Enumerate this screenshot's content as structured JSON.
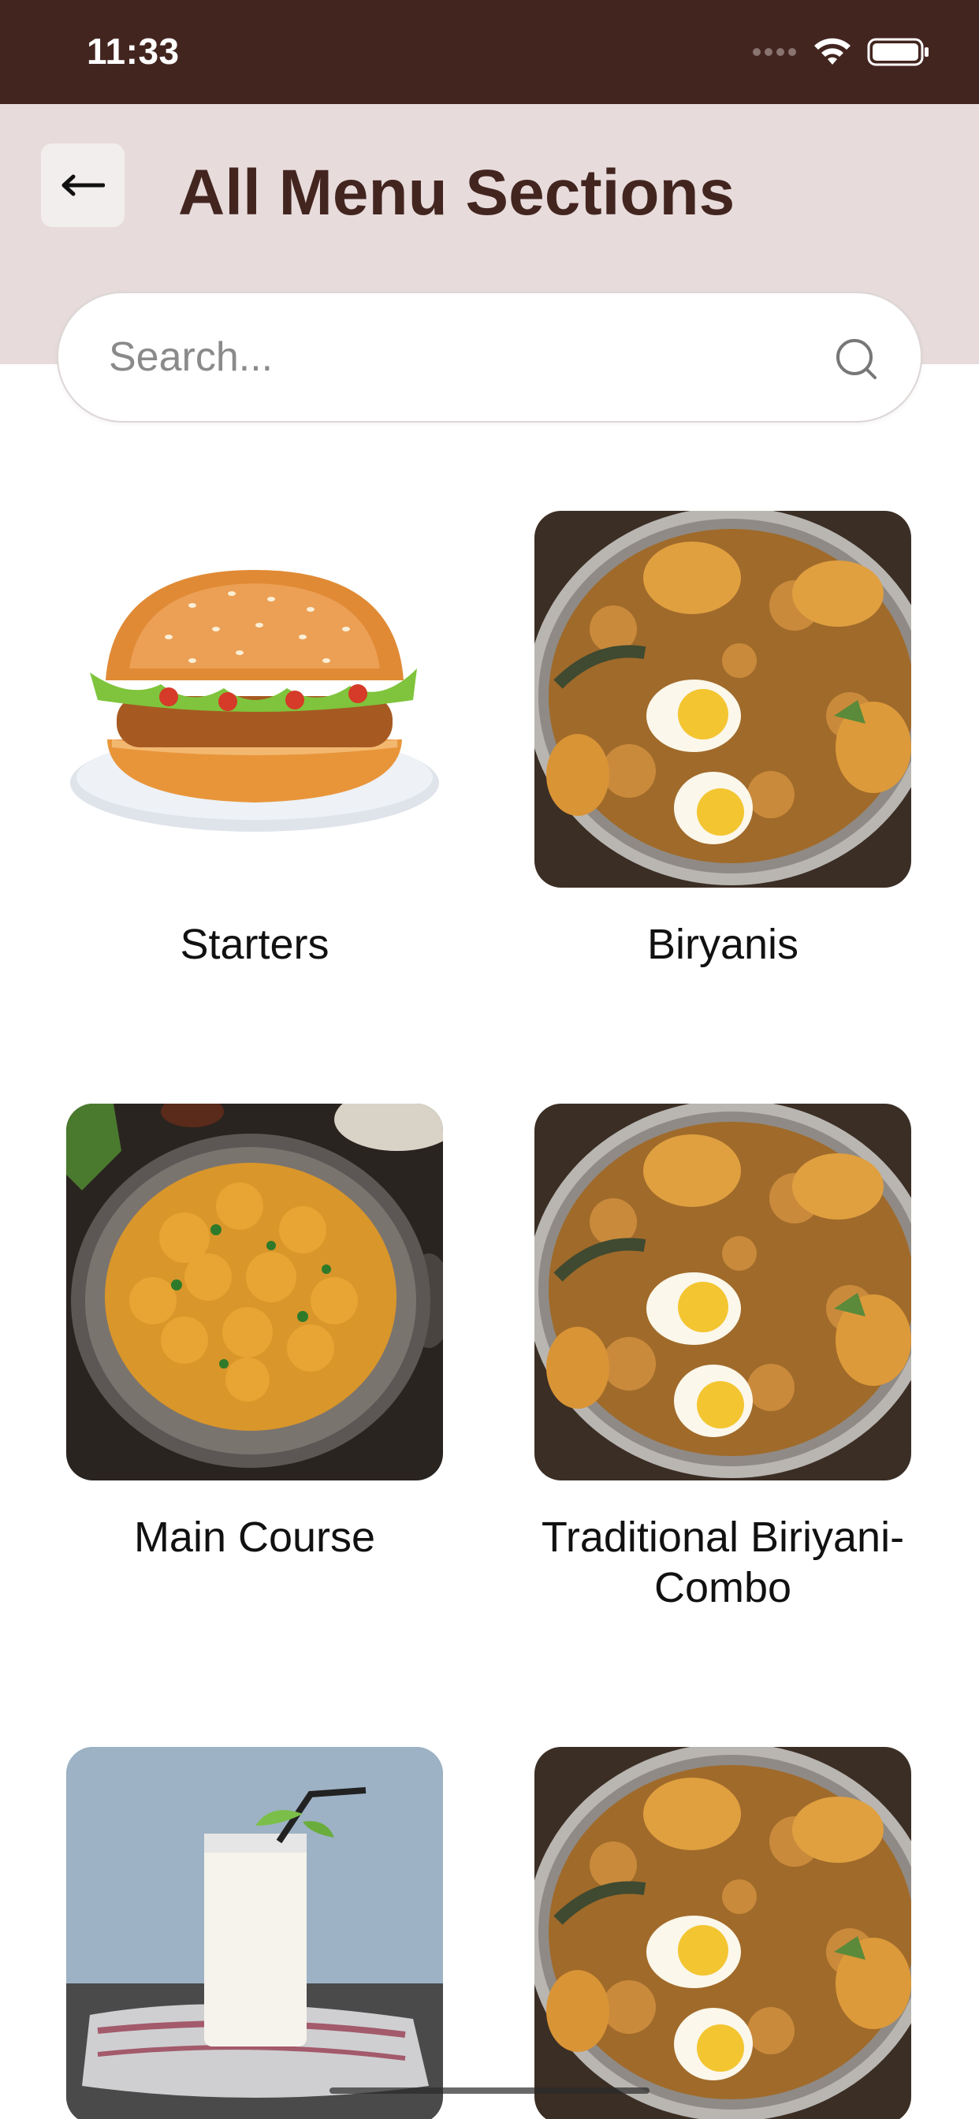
{
  "status_bar": {
    "time": "11:33",
    "icons": [
      "cellular-dots-icon",
      "wifi-icon",
      "battery-icon"
    ]
  },
  "header": {
    "title": "All Menu Sections",
    "back_icon": "arrow-left-icon",
    "background": "#e7dcdb",
    "title_color": "#432520"
  },
  "search": {
    "placeholder": "Search...",
    "value": "",
    "icon": "search-icon"
  },
  "sections": [
    {
      "label": "Starters",
      "image": "burger"
    },
    {
      "label": "Biryanis",
      "image": "egg-biryani"
    },
    {
      "label": "Main Course",
      "image": "curry-bowl"
    },
    {
      "label": "Traditional Biriyani-Combo",
      "image": "egg-biryani"
    },
    {
      "label": "",
      "image": "milk-glass"
    },
    {
      "label": "",
      "image": "egg-biryani"
    }
  ],
  "colors": {
    "status_bar": "#432520",
    "accent": "#432520"
  }
}
